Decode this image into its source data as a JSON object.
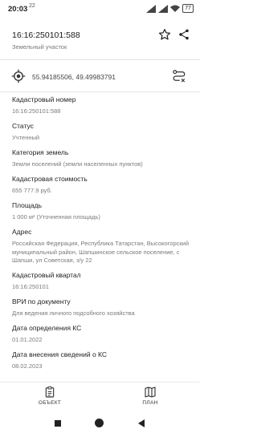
{
  "status_bar": {
    "time": "20:03",
    "time_superscript": "22",
    "battery": "77"
  },
  "header": {
    "title": "16:16:250101:588",
    "subtitle": "Земельный участок"
  },
  "coordinates": "55.94185506, 49.49983791",
  "fields": [
    {
      "label": "Кадастровый номер",
      "value": "16:16:250101:588"
    },
    {
      "label": "Статус",
      "value": "Учтенный"
    },
    {
      "label": "Категория земель",
      "value": "Земли поселений (земли населенных пунктов)"
    },
    {
      "label": "Кадастровая стоимость",
      "value": "655 777.9 руб."
    },
    {
      "label": "Площадь",
      "value": "1 000 м² (Уточненная площадь)"
    },
    {
      "label": "Адрес",
      "value": "Российская Федерация, Республика Татарстан, Высокогорский муниципальный район, Шапшинское сельское поселение, с Шапши, ул Советская, з/у 22"
    },
    {
      "label": "Кадастровый квартал",
      "value": "16:16:250101"
    },
    {
      "label": "ВРИ по документу",
      "value": "Для ведения личного подсобного хозяйства"
    },
    {
      "label": "Дата определения КС",
      "value": "01.01.2022"
    },
    {
      "label": "Дата внесения сведений о КС",
      "value": "08.02.2023"
    }
  ],
  "bottom_nav": {
    "objects_label": "ОБЪЕКТ",
    "plan_label": "ПЛАН"
  }
}
